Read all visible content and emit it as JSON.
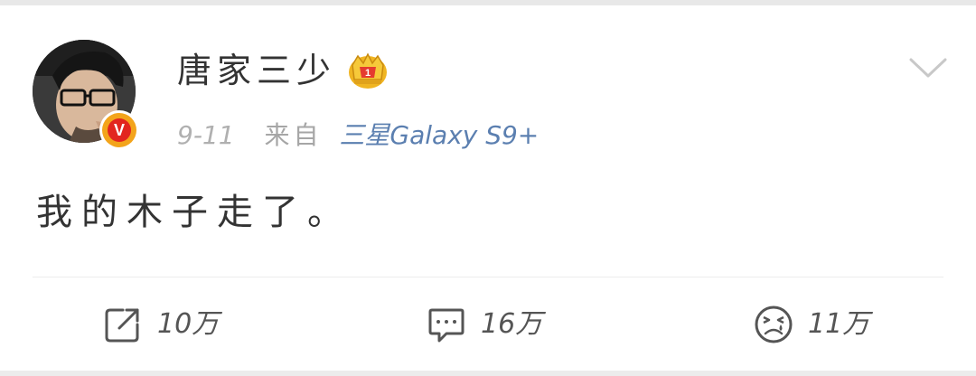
{
  "post": {
    "username": "唐家三少",
    "date": "9-11",
    "source_prefix": "来自",
    "device": "三星Galaxy S9+",
    "text": "我的木子走了。"
  },
  "badges": {
    "verified_letter": "V",
    "crown_icon": "crown-icon",
    "verified_icon": "verified-v-icon"
  },
  "actions": {
    "repost_count": "10万",
    "comment_count": "16万",
    "like_count": "11万"
  },
  "colors": {
    "accent_link": "#5b7fb0",
    "verified_orange": "#f3a41b",
    "verified_red": "#e2261f",
    "crown_gold": "#f0b522",
    "crown_red": "#e53b2f"
  }
}
